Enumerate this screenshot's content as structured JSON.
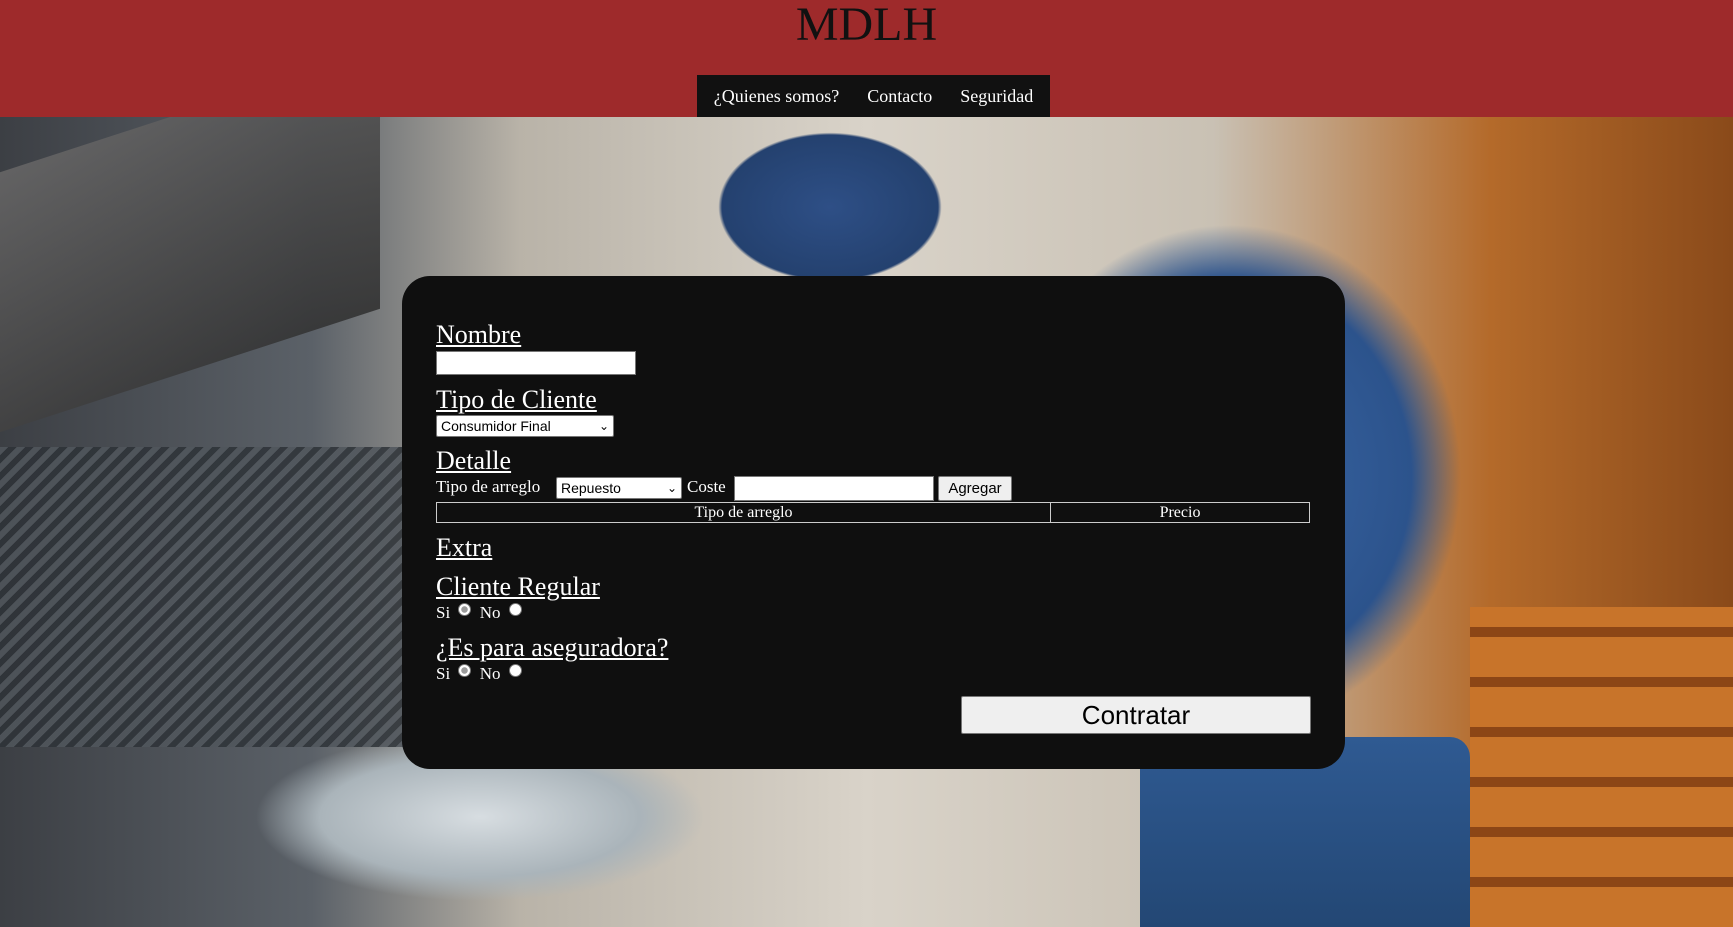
{
  "header": {
    "title": "MDLH",
    "nav": [
      "¿Quienes somos?",
      "Contacto",
      "Seguridad"
    ]
  },
  "form": {
    "nombre_label": "Nombre",
    "nombre_value": "",
    "tipo_cliente_label": "Tipo de Cliente",
    "tipo_cliente_value": "Consumidor Final",
    "detalle_label": "Detalle",
    "tipo_arreglo_label": "Tipo de arreglo",
    "tipo_arreglo_value": "Repuesto",
    "coste_label": "Coste",
    "coste_value": "",
    "agregar_label": "Agregar",
    "table_headers": [
      "Tipo de arreglo",
      "Precio"
    ],
    "extra_label": "Extra",
    "cliente_regular_label": "Cliente Regular",
    "aseguradora_label": "¿Es para aseguradora?",
    "si_label": "Si",
    "no_label": "No",
    "contratar_label": "Contratar"
  },
  "colors": {
    "header_bg": "#9e2a2b",
    "nav_bg": "#111111",
    "panel_bg": "#0f0f0f"
  },
  "icons": {
    "select_arrow": "chevron-down-icon"
  }
}
